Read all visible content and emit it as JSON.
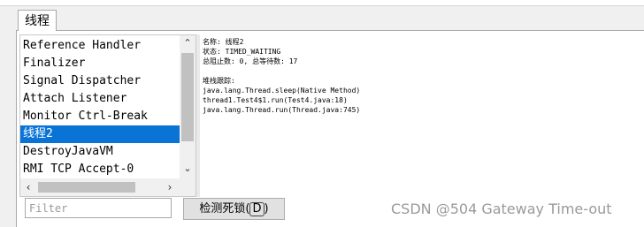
{
  "tabs": [
    {
      "label": "线程"
    }
  ],
  "threads": {
    "items": [
      {
        "label": "Reference Handler",
        "selected": false
      },
      {
        "label": "Finalizer",
        "selected": false
      },
      {
        "label": "Signal Dispatcher",
        "selected": false
      },
      {
        "label": "Attach Listener",
        "selected": false
      },
      {
        "label": "Monitor Ctrl-Break",
        "selected": false
      },
      {
        "label": "线程2",
        "selected": true
      },
      {
        "label": "DestroyJavaVM",
        "selected": false
      },
      {
        "label": "RMI TCP Accept-0",
        "selected": false
      }
    ],
    "selection_color": "#0a74d6"
  },
  "details": {
    "name_line": "名称: 线程2",
    "state_line": "状态: TIMED_WAITING",
    "counts_line": "总阻止数: 0, 总等待数: 17",
    "stack_title": "堆栈跟踪:",
    "stack": [
      "java.lang.Thread.sleep(Native Method)",
      "thread1.Test4$1.run(Test4.java:18)",
      "java.lang.Thread.run(Thread.java:745)"
    ]
  },
  "filter": {
    "placeholder": "Filter",
    "value": ""
  },
  "detect_button": {
    "label": "检测死锁(",
    "mnemonic": "D",
    "suffix": ")"
  },
  "watermark": "CSDN @504 Gateway Time-out"
}
